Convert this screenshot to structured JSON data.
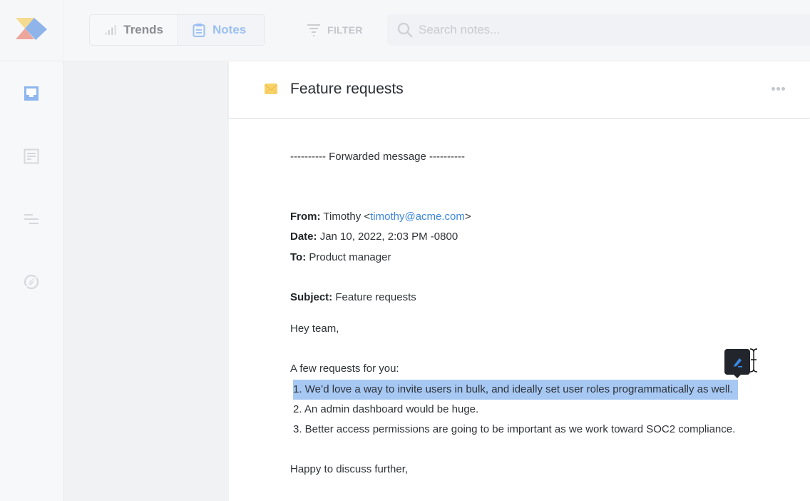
{
  "topbar": {
    "tabs": [
      {
        "label": "Trends",
        "icon": "bar-chart-icon",
        "active": false
      },
      {
        "label": "Notes",
        "icon": "clipboard-icon",
        "active": true
      }
    ],
    "filter_label": "FILTER",
    "search_placeholder": "Search notes...",
    "search_value": ""
  },
  "sidebar": {
    "items": [
      {
        "name": "inbox",
        "icon": "inbox-icon",
        "active": true
      },
      {
        "name": "notes",
        "icon": "document-icon",
        "active": false
      },
      {
        "name": "roadmap",
        "icon": "lines-icon",
        "active": false
      },
      {
        "name": "explore",
        "icon": "compass-icon",
        "active": false
      }
    ]
  },
  "note": {
    "title": "Feature requests",
    "icon": "envelope-icon",
    "forwarded_line": "---------- Forwarded message ----------",
    "from_label": "From:",
    "from_name": "Timothy <",
    "from_email": "timothy@acme.com",
    "from_close": ">",
    "date_label": "Date:",
    "date_value": "Jan 10, 2022, 2:03 PM -0800",
    "to_label": "To:",
    "to_value": "Product manager",
    "subject_label": "Subject:",
    "subject_value": "Feature requests",
    "greeting": "Hey team,",
    "intro": "A few requests for you:",
    "requests": [
      "1. We’d love a way to invite users in bulk, and ideally set user roles programmatically as well.",
      "2. An admin dashboard would be huge.",
      "3. Better access permissions are going to be important as we work toward SOC2 compliance."
    ],
    "closing": "Happy to discuss further,"
  },
  "colors": {
    "accent": "#3b87e0",
    "selection": "#a6c8f3",
    "active_tab": "#9cc0f2"
  }
}
